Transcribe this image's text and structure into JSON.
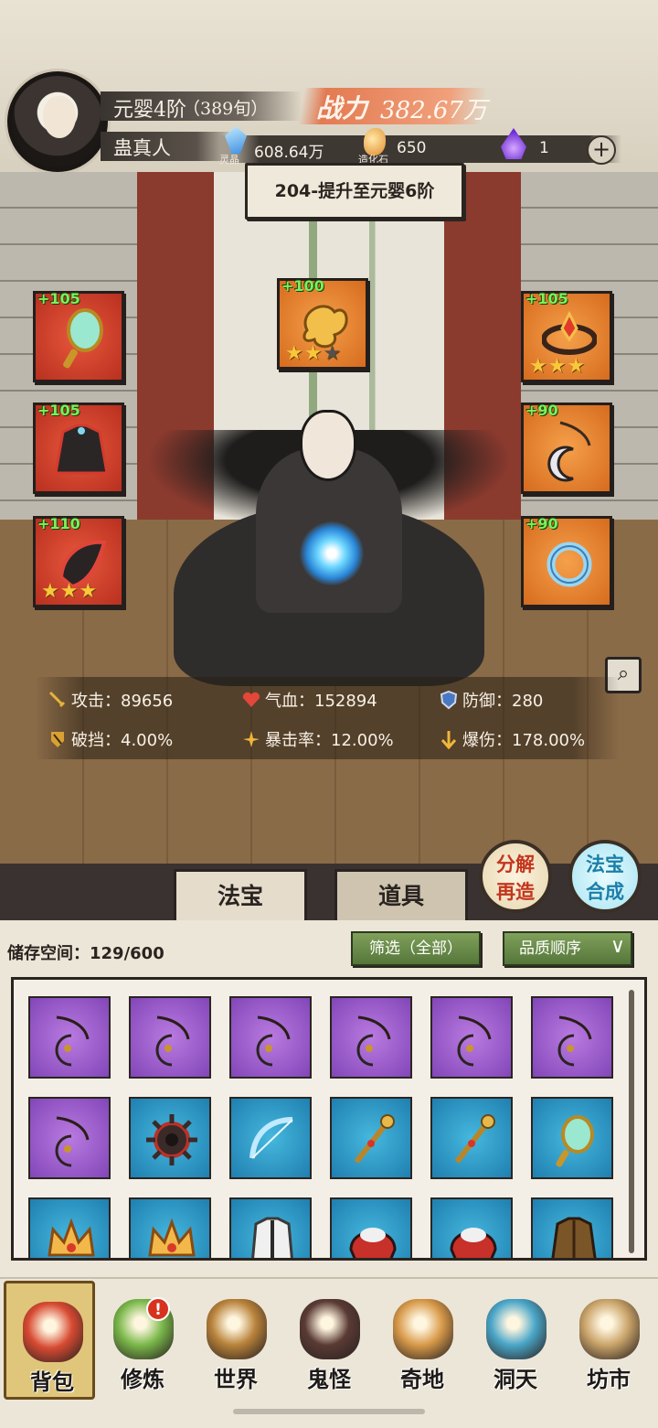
{
  "header": {
    "realm": "元婴4阶",
    "age": "（389旬）",
    "player_name": "蛊真人",
    "power_label": "战力",
    "power_value": "382.67万",
    "resources": [
      {
        "icon": "spirit-crystal-icon",
        "label": "灵晶",
        "value": "608.64万"
      },
      {
        "icon": "creation-stone-icon",
        "label": "造化石",
        "value": "650"
      },
      {
        "icon": "purple-flame-icon",
        "label": "",
        "value": "1"
      }
    ],
    "plus_symbol": "+"
  },
  "quest": {
    "text": "204-提升至元婴6阶"
  },
  "equipment": [
    {
      "slot": "left-1",
      "level": "+105",
      "rarity": "red",
      "icon": "jade-mirror-icon",
      "stars": 0
    },
    {
      "slot": "top-center",
      "level": "+100",
      "rarity": "orange",
      "icon": "golden-cloud-icon",
      "stars": 2,
      "max_stars": 3
    },
    {
      "slot": "right-1",
      "level": "+105",
      "rarity": "orange",
      "icon": "crown-circlet-icon",
      "stars": 3
    },
    {
      "slot": "left-2",
      "level": "+105",
      "rarity": "red",
      "icon": "dark-robe-icon",
      "stars": 0
    },
    {
      "slot": "right-2",
      "level": "+90",
      "rarity": "orange",
      "icon": "crescent-pendant-icon",
      "stars": 0
    },
    {
      "slot": "left-3",
      "level": "+110",
      "rarity": "red",
      "icon": "dark-boots-icon",
      "stars": 3
    },
    {
      "slot": "right-3",
      "level": "+90",
      "rarity": "orange",
      "icon": "dragon-bracelet-icon",
      "stars": 0
    }
  ],
  "stats": [
    {
      "icon": "sword-icon",
      "label": "攻击：89656"
    },
    {
      "icon": "heart-icon",
      "label": "气血：152894"
    },
    {
      "icon": "shield-icon",
      "label": "防御：280"
    },
    {
      "icon": "armor-break-icon",
      "label": "破挡：4.00%"
    },
    {
      "icon": "crit-rate-icon",
      "label": "暴击率：12.00%"
    },
    {
      "icon": "crit-damage-icon",
      "label": "爆伤：178.00%"
    }
  ],
  "actions": {
    "decompose": "分解再造",
    "synthesize": "法宝合成"
  },
  "tabs": [
    {
      "label": "法宝",
      "active": true
    },
    {
      "label": "道具",
      "active": false
    }
  ],
  "inventory": {
    "storage_label": "储存空间：129/600",
    "filter_label": "筛选（全部）",
    "sort_label": "品质顺序",
    "items": [
      {
        "rarity": "purple",
        "icon": "crescent-pendant-icon"
      },
      {
        "rarity": "purple",
        "icon": "crescent-pendant-icon"
      },
      {
        "rarity": "purple",
        "icon": "crescent-pendant-icon"
      },
      {
        "rarity": "purple",
        "icon": "crescent-pendant-icon"
      },
      {
        "rarity": "purple",
        "icon": "crescent-pendant-icon"
      },
      {
        "rarity": "purple",
        "icon": "crescent-pendant-icon"
      },
      {
        "rarity": "purple",
        "icon": "crescent-pendant-icon"
      },
      {
        "rarity": "blue",
        "icon": "spiked-wheel-icon"
      },
      {
        "rarity": "blue",
        "icon": "ice-bow-icon"
      },
      {
        "rarity": "blue",
        "icon": "golden-staff-icon"
      },
      {
        "rarity": "blue",
        "icon": "golden-staff-icon"
      },
      {
        "rarity": "blue",
        "icon": "jade-mirror-icon"
      },
      {
        "rarity": "blue",
        "icon": "golden-crown-icon"
      },
      {
        "rarity": "blue",
        "icon": "golden-crown-icon"
      },
      {
        "rarity": "blue",
        "icon": "white-armor-icon"
      },
      {
        "rarity": "blue",
        "icon": "red-helmet-icon"
      },
      {
        "rarity": "blue",
        "icon": "red-helmet-icon"
      },
      {
        "rarity": "blue",
        "icon": "brown-coat-icon"
      }
    ]
  },
  "nav": [
    {
      "label": "背包",
      "icon": "backpack-icon",
      "active": true
    },
    {
      "label": "修炼",
      "icon": "cultivate-flower-icon",
      "badge": "!"
    },
    {
      "label": "世界",
      "icon": "world-scroll-icon"
    },
    {
      "label": "鬼怪",
      "icon": "ghost-egg-icon"
    },
    {
      "label": "奇地",
      "icon": "wonder-land-icon"
    },
    {
      "label": "洞天",
      "icon": "cave-heaven-icon"
    },
    {
      "label": "坊市",
      "icon": "market-stall-icon"
    }
  ],
  "colors": {
    "rarity_red": "#d9442b",
    "rarity_orange": "#e8842f",
    "rarity_purple": "#9a5ccc",
    "rarity_blue": "#2f96c6",
    "level_text": "#7cf05a",
    "star": "#f8c83a",
    "power_plate": "#e37a52"
  }
}
